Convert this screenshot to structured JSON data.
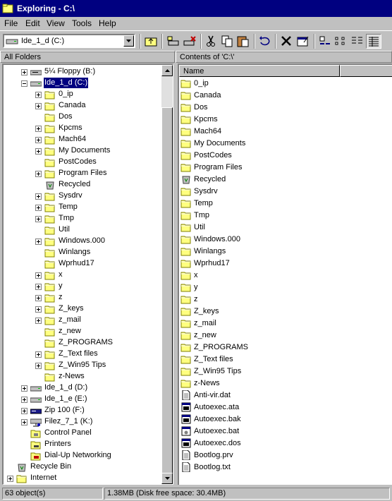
{
  "window": {
    "title": "Exploring - C:\\"
  },
  "menu": [
    "File",
    "Edit",
    "View",
    "Tools",
    "Help"
  ],
  "address": {
    "value": "Ide_1_d (C:)"
  },
  "toolbar": {
    "buttons": [
      "up-one-level",
      "map-drive",
      "disconnect-drive",
      "cut",
      "copy",
      "paste",
      "undo",
      "delete",
      "properties",
      "large-icons",
      "small-icons",
      "list",
      "details"
    ]
  },
  "left_header": "All Folders",
  "right_header": "Contents of 'C:\\'",
  "column_header": "Name",
  "tree": [
    {
      "label": "5¼ Floppy (B:)",
      "icon": "floppy-drive-icon",
      "expander": "plus",
      "depth": 1
    },
    {
      "label": "Ide_1_d (C:)",
      "icon": "hard-drive-icon",
      "expander": "minus",
      "depth": 1,
      "selected": true
    },
    {
      "label": "0_ip",
      "icon": "folder-icon",
      "expander": "plus",
      "depth": 2
    },
    {
      "label": "Canada",
      "icon": "folder-icon",
      "expander": "plus",
      "depth": 2
    },
    {
      "label": "Dos",
      "icon": "folder-icon",
      "expander": "",
      "depth": 2
    },
    {
      "label": "Kpcms",
      "icon": "folder-icon",
      "expander": "plus",
      "depth": 2
    },
    {
      "label": "Mach64",
      "icon": "folder-icon",
      "expander": "plus",
      "depth": 2
    },
    {
      "label": "My Documents",
      "icon": "folder-icon",
      "expander": "plus",
      "depth": 2
    },
    {
      "label": "PostCodes",
      "icon": "folder-icon",
      "expander": "",
      "depth": 2
    },
    {
      "label": "Program Files",
      "icon": "folder-icon",
      "expander": "plus",
      "depth": 2
    },
    {
      "label": "Recycled",
      "icon": "recycle-bin-icon",
      "expander": "",
      "depth": 2
    },
    {
      "label": "Sysdrv",
      "icon": "folder-icon",
      "expander": "plus",
      "depth": 2
    },
    {
      "label": "Temp",
      "icon": "folder-icon",
      "expander": "plus",
      "depth": 2
    },
    {
      "label": "Tmp",
      "icon": "folder-icon",
      "expander": "plus",
      "depth": 2
    },
    {
      "label": "Util",
      "icon": "folder-icon",
      "expander": "",
      "depth": 2
    },
    {
      "label": "Windows.000",
      "icon": "folder-icon",
      "expander": "plus",
      "depth": 2
    },
    {
      "label": "Winlangs",
      "icon": "folder-icon",
      "expander": "",
      "depth": 2
    },
    {
      "label": "Wprhud17",
      "icon": "folder-icon",
      "expander": "",
      "depth": 2
    },
    {
      "label": "x",
      "icon": "folder-icon",
      "expander": "plus",
      "depth": 2
    },
    {
      "label": "y",
      "icon": "folder-icon",
      "expander": "plus",
      "depth": 2
    },
    {
      "label": "z",
      "icon": "folder-icon",
      "expander": "plus",
      "depth": 2
    },
    {
      "label": "Z_keys",
      "icon": "folder-icon",
      "expander": "plus",
      "depth": 2
    },
    {
      "label": "z_mail",
      "icon": "folder-icon",
      "expander": "plus",
      "depth": 2
    },
    {
      "label": "z_new",
      "icon": "folder-icon",
      "expander": "",
      "depth": 2
    },
    {
      "label": "Z_PROGRAMS",
      "icon": "folder-icon",
      "expander": "",
      "depth": 2
    },
    {
      "label": "Z_Text files",
      "icon": "folder-icon",
      "expander": "plus",
      "depth": 2
    },
    {
      "label": "Z_Win95 Tips",
      "icon": "folder-icon",
      "expander": "plus",
      "depth": 2
    },
    {
      "label": "z-News",
      "icon": "folder-icon",
      "expander": "",
      "depth": 2
    },
    {
      "label": "Ide_1_d (D:)",
      "icon": "hard-drive-icon",
      "expander": "plus",
      "depth": 1
    },
    {
      "label": "Ide_1_e (E:)",
      "icon": "hard-drive-icon",
      "expander": "plus",
      "depth": 1
    },
    {
      "label": "Zip 100 (F:)",
      "icon": "zip-drive-icon",
      "expander": "plus",
      "depth": 1
    },
    {
      "label": "Filez_7_1 (K:)",
      "icon": "network-drive-icon",
      "expander": "plus",
      "depth": 1
    },
    {
      "label": "Control Panel",
      "icon": "control-panel-icon",
      "expander": "",
      "depth": 1
    },
    {
      "label": "Printers",
      "icon": "printers-icon",
      "expander": "",
      "depth": 1
    },
    {
      "label": "Dial-Up Networking",
      "icon": "dialup-icon",
      "expander": "",
      "depth": 1
    },
    {
      "label": "Recycle Bin",
      "icon": "recycle-bin-icon",
      "expander": "",
      "depth": 0
    },
    {
      "label": "Internet",
      "icon": "folder-icon",
      "expander": "plus",
      "depth": 0
    }
  ],
  "files": [
    {
      "name": "0_ip",
      "icon": "folder-icon"
    },
    {
      "name": "Canada",
      "icon": "folder-icon"
    },
    {
      "name": "Dos",
      "icon": "folder-icon"
    },
    {
      "name": "Kpcms",
      "icon": "folder-icon"
    },
    {
      "name": "Mach64",
      "icon": "folder-icon"
    },
    {
      "name": "My Documents",
      "icon": "folder-icon"
    },
    {
      "name": "PostCodes",
      "icon": "folder-icon"
    },
    {
      "name": "Program Files",
      "icon": "folder-icon"
    },
    {
      "name": "Recycled",
      "icon": "recycle-bin-icon"
    },
    {
      "name": "Sysdrv",
      "icon": "folder-icon"
    },
    {
      "name": "Temp",
      "icon": "folder-icon"
    },
    {
      "name": "Tmp",
      "icon": "folder-icon"
    },
    {
      "name": "Util",
      "icon": "folder-icon"
    },
    {
      "name": "Windows.000",
      "icon": "folder-icon"
    },
    {
      "name": "Winlangs",
      "icon": "folder-icon"
    },
    {
      "name": "Wprhud17",
      "icon": "folder-icon"
    },
    {
      "name": "x",
      "icon": "folder-icon"
    },
    {
      "name": "y",
      "icon": "folder-icon"
    },
    {
      "name": "z",
      "icon": "folder-icon"
    },
    {
      "name": "Z_keys",
      "icon": "folder-icon"
    },
    {
      "name": "z_mail",
      "icon": "folder-icon"
    },
    {
      "name": "z_new",
      "icon": "folder-icon"
    },
    {
      "name": "Z_PROGRAMS",
      "icon": "folder-icon"
    },
    {
      "name": "Z_Text files",
      "icon": "folder-icon"
    },
    {
      "name": "Z_Win95 Tips",
      "icon": "folder-icon"
    },
    {
      "name": "z-News",
      "icon": "folder-icon"
    },
    {
      "name": "Anti-vir.dat",
      "icon": "text-file-icon"
    },
    {
      "name": "Autoexec.ata",
      "icon": "ms-dos-file-icon"
    },
    {
      "name": "Autoexec.bak",
      "icon": "ms-dos-file-icon"
    },
    {
      "name": "Autoexec.bat",
      "icon": "batch-file-icon"
    },
    {
      "name": "Autoexec.dos",
      "icon": "ms-dos-file-icon"
    },
    {
      "name": "Bootlog.prv",
      "icon": "text-file-icon"
    },
    {
      "name": "Bootlog.txt",
      "icon": "text-file-icon"
    }
  ],
  "status": {
    "objects": "63 object(s)",
    "disk": "1.38MB (Disk free space: 30.4MB)"
  },
  "colors": {
    "title_bar": "#000080",
    "face": "#c0c0c0",
    "folder": "#ffff80",
    "selection": "#000080"
  }
}
